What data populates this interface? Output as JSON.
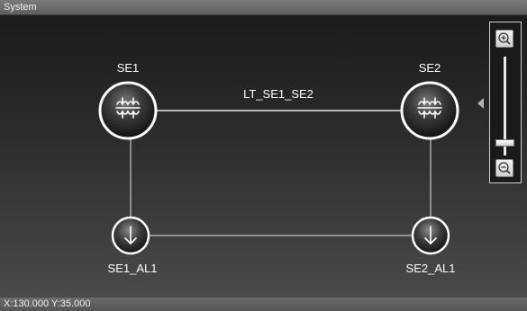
{
  "window": {
    "title": "System"
  },
  "status": {
    "coordinates": "X:130.000 Y:35.000"
  },
  "diagram": {
    "nodes": [
      {
        "id": "SE1",
        "label": "SE1",
        "type": "substation",
        "icon": "transformer-icon"
      },
      {
        "id": "SE2",
        "label": "SE2",
        "type": "substation",
        "icon": "transformer-icon"
      },
      {
        "id": "SE1_AL1",
        "label": "SE1_AL1",
        "type": "load",
        "icon": "load-arrow-icon"
      },
      {
        "id": "SE2_AL1",
        "label": "SE2_AL1",
        "type": "load",
        "icon": "load-arrow-icon"
      }
    ],
    "links": [
      {
        "from": "SE1",
        "to": "SE2",
        "label": "LT_SE1_SE2"
      },
      {
        "from": "SE1",
        "to": "SE1_AL1",
        "label": ""
      },
      {
        "from": "SE2",
        "to": "SE2_AL1",
        "label": ""
      },
      {
        "from": "SE1_AL1",
        "to": "SE2_AL1",
        "label": ""
      }
    ]
  },
  "zoom": {
    "zoom_in_icon": "zoom-in-icon",
    "zoom_out_icon": "zoom-out-icon",
    "level_fraction": 0.1
  },
  "colors": {
    "node_dark": "#2a2a2a",
    "node_ring": "#ffffff",
    "link": "#e6e6e6"
  }
}
